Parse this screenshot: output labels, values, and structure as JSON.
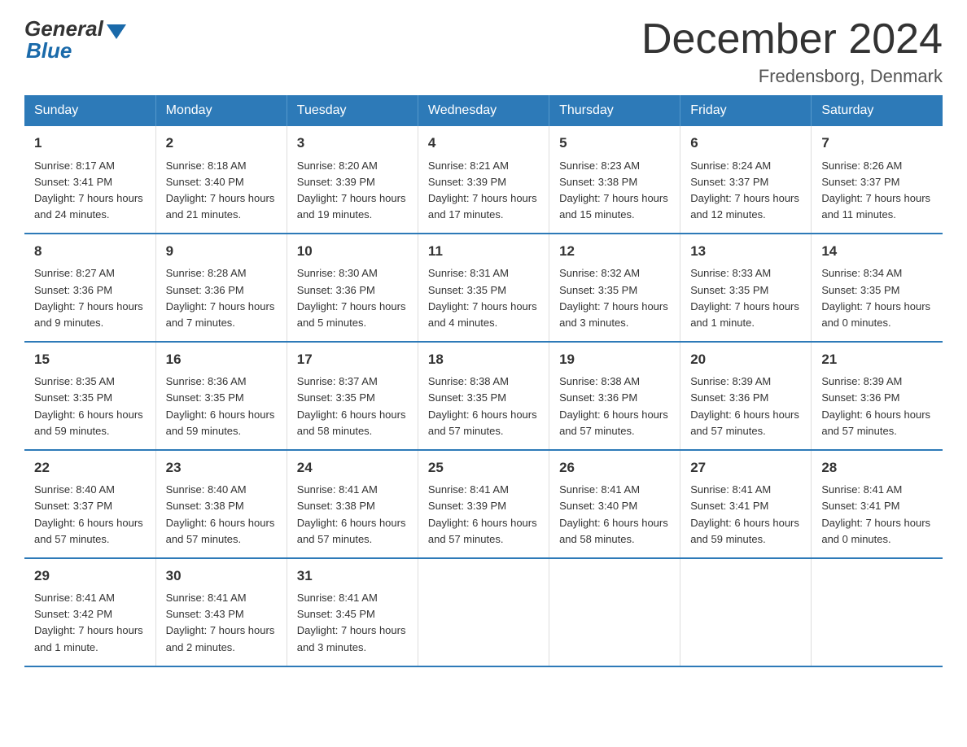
{
  "logo": {
    "general": "General",
    "blue": "Blue"
  },
  "title": "December 2024",
  "location": "Fredensborg, Denmark",
  "days_of_week": [
    "Sunday",
    "Monday",
    "Tuesday",
    "Wednesday",
    "Thursday",
    "Friday",
    "Saturday"
  ],
  "weeks": [
    [
      {
        "day": "1",
        "sunrise": "8:17 AM",
        "sunset": "3:41 PM",
        "daylight": "7 hours and 24 minutes."
      },
      {
        "day": "2",
        "sunrise": "8:18 AM",
        "sunset": "3:40 PM",
        "daylight": "7 hours and 21 minutes."
      },
      {
        "day": "3",
        "sunrise": "8:20 AM",
        "sunset": "3:39 PM",
        "daylight": "7 hours and 19 minutes."
      },
      {
        "day": "4",
        "sunrise": "8:21 AM",
        "sunset": "3:39 PM",
        "daylight": "7 hours and 17 minutes."
      },
      {
        "day": "5",
        "sunrise": "8:23 AM",
        "sunset": "3:38 PM",
        "daylight": "7 hours and 15 minutes."
      },
      {
        "day": "6",
        "sunrise": "8:24 AM",
        "sunset": "3:37 PM",
        "daylight": "7 hours and 12 minutes."
      },
      {
        "day": "7",
        "sunrise": "8:26 AM",
        "sunset": "3:37 PM",
        "daylight": "7 hours and 11 minutes."
      }
    ],
    [
      {
        "day": "8",
        "sunrise": "8:27 AM",
        "sunset": "3:36 PM",
        "daylight": "7 hours and 9 minutes."
      },
      {
        "day": "9",
        "sunrise": "8:28 AM",
        "sunset": "3:36 PM",
        "daylight": "7 hours and 7 minutes."
      },
      {
        "day": "10",
        "sunrise": "8:30 AM",
        "sunset": "3:36 PM",
        "daylight": "7 hours and 5 minutes."
      },
      {
        "day": "11",
        "sunrise": "8:31 AM",
        "sunset": "3:35 PM",
        "daylight": "7 hours and 4 minutes."
      },
      {
        "day": "12",
        "sunrise": "8:32 AM",
        "sunset": "3:35 PM",
        "daylight": "7 hours and 3 minutes."
      },
      {
        "day": "13",
        "sunrise": "8:33 AM",
        "sunset": "3:35 PM",
        "daylight": "7 hours and 1 minute."
      },
      {
        "day": "14",
        "sunrise": "8:34 AM",
        "sunset": "3:35 PM",
        "daylight": "7 hours and 0 minutes."
      }
    ],
    [
      {
        "day": "15",
        "sunrise": "8:35 AM",
        "sunset": "3:35 PM",
        "daylight": "6 hours and 59 minutes."
      },
      {
        "day": "16",
        "sunrise": "8:36 AM",
        "sunset": "3:35 PM",
        "daylight": "6 hours and 59 minutes."
      },
      {
        "day": "17",
        "sunrise": "8:37 AM",
        "sunset": "3:35 PM",
        "daylight": "6 hours and 58 minutes."
      },
      {
        "day": "18",
        "sunrise": "8:38 AM",
        "sunset": "3:35 PM",
        "daylight": "6 hours and 57 minutes."
      },
      {
        "day": "19",
        "sunrise": "8:38 AM",
        "sunset": "3:36 PM",
        "daylight": "6 hours and 57 minutes."
      },
      {
        "day": "20",
        "sunrise": "8:39 AM",
        "sunset": "3:36 PM",
        "daylight": "6 hours and 57 minutes."
      },
      {
        "day": "21",
        "sunrise": "8:39 AM",
        "sunset": "3:36 PM",
        "daylight": "6 hours and 57 minutes."
      }
    ],
    [
      {
        "day": "22",
        "sunrise": "8:40 AM",
        "sunset": "3:37 PM",
        "daylight": "6 hours and 57 minutes."
      },
      {
        "day": "23",
        "sunrise": "8:40 AM",
        "sunset": "3:38 PM",
        "daylight": "6 hours and 57 minutes."
      },
      {
        "day": "24",
        "sunrise": "8:41 AM",
        "sunset": "3:38 PM",
        "daylight": "6 hours and 57 minutes."
      },
      {
        "day": "25",
        "sunrise": "8:41 AM",
        "sunset": "3:39 PM",
        "daylight": "6 hours and 57 minutes."
      },
      {
        "day": "26",
        "sunrise": "8:41 AM",
        "sunset": "3:40 PM",
        "daylight": "6 hours and 58 minutes."
      },
      {
        "day": "27",
        "sunrise": "8:41 AM",
        "sunset": "3:41 PM",
        "daylight": "6 hours and 59 minutes."
      },
      {
        "day": "28",
        "sunrise": "8:41 AM",
        "sunset": "3:41 PM",
        "daylight": "7 hours and 0 minutes."
      }
    ],
    [
      {
        "day": "29",
        "sunrise": "8:41 AM",
        "sunset": "3:42 PM",
        "daylight": "7 hours and 1 minute."
      },
      {
        "day": "30",
        "sunrise": "8:41 AM",
        "sunset": "3:43 PM",
        "daylight": "7 hours and 2 minutes."
      },
      {
        "day": "31",
        "sunrise": "8:41 AM",
        "sunset": "3:45 PM",
        "daylight": "7 hours and 3 minutes."
      },
      null,
      null,
      null,
      null
    ]
  ],
  "labels": {
    "sunrise": "Sunrise:",
    "sunset": "Sunset:",
    "daylight": "Daylight:"
  }
}
